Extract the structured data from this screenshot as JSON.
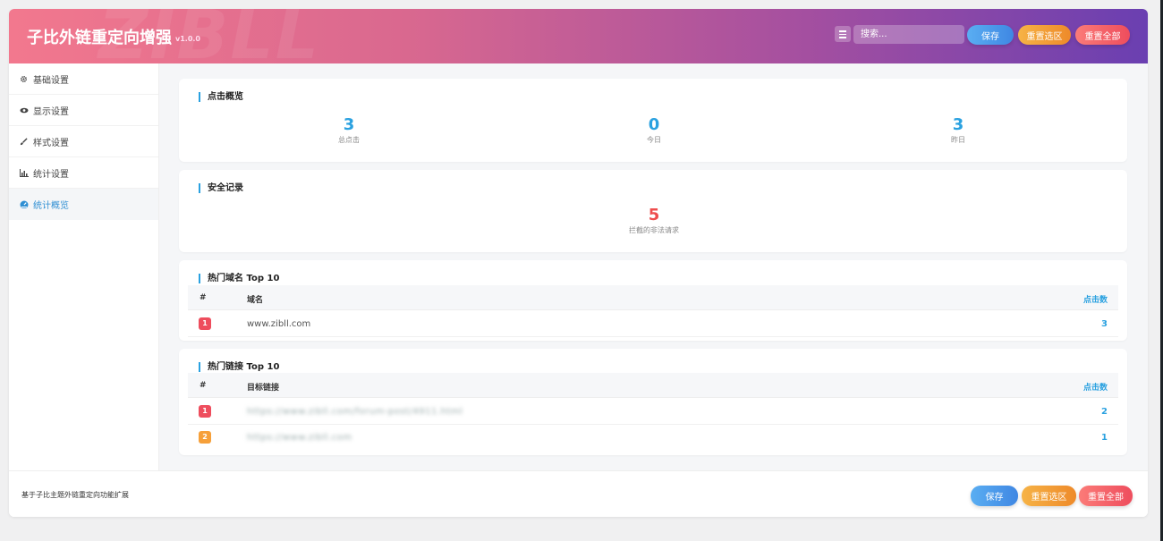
{
  "header": {
    "title": "子比外链重定向增强",
    "version": "v1.0.0",
    "watermark": "ZIBLL",
    "search_placeholder": "搜索...",
    "save_label": "保存",
    "reset_section_label": "重置选区",
    "reset_all_label": "重置全部"
  },
  "sidebar": {
    "items": [
      {
        "label": "基础设置",
        "icon": "gear-icon",
        "active": false
      },
      {
        "label": "显示设置",
        "icon": "eye-icon",
        "active": false
      },
      {
        "label": "样式设置",
        "icon": "brush-icon",
        "active": false
      },
      {
        "label": "统计设置",
        "icon": "bar-chart-icon",
        "active": false
      },
      {
        "label": "统计概览",
        "icon": "dashboard-icon",
        "active": true
      }
    ]
  },
  "clicks_overview": {
    "title": "点击概览",
    "stats": [
      {
        "value": "3",
        "label": "总点击"
      },
      {
        "value": "0",
        "label": "今日"
      },
      {
        "value": "3",
        "label": "昨日"
      }
    ]
  },
  "security": {
    "title": "安全记录",
    "value": "5",
    "label": "拦截的非法请求"
  },
  "top_domains": {
    "title": "热门域名 Top 10",
    "columns": [
      "#",
      "域名",
      "点击数"
    ],
    "rows": [
      {
        "rank": "1",
        "name": "www.zibll.com",
        "count": "3"
      }
    ]
  },
  "top_links": {
    "title": "热门链接 Top 10",
    "columns": [
      "#",
      "目标链接",
      "点击数"
    ],
    "rows": [
      {
        "rank": "1",
        "name": "https://www.zibll.com/forum-post/4911.html",
        "count": "2"
      },
      {
        "rank": "2",
        "name": "https://www.zibll.com",
        "count": "1"
      }
    ]
  },
  "footer": {
    "text": "基于子比主题外链重定向功能扩展",
    "save_label": "保存",
    "reset_section_label": "重置选区",
    "reset_all_label": "重置全部"
  },
  "colors": {
    "accent": "#2aa1e0",
    "danger": "#ee4d4d",
    "header_gradient_start": "#f2788e",
    "header_gradient_end": "#6a3fb1"
  }
}
